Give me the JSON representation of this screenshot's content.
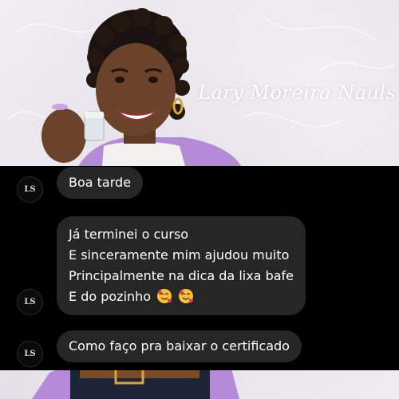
{
  "brand": {
    "signature": "Lary Moreira Nauls"
  },
  "messages": [
    {
      "lines": [
        "Boa tarde"
      ]
    },
    {
      "lines": [
        "Já terminei o curso",
        "E sinceramente mim ajudou muito",
        "Principalmente na dica da lixa bafe",
        "E do pozinho"
      ],
      "trailing_emojis": [
        "smiling-face-with-hearts",
        "smiling-face-with-hearts"
      ]
    },
    {
      "lines": [
        "Como faço pra baixar o certificado"
      ]
    }
  ],
  "sender_avatar": {
    "initials": "LS"
  },
  "colors": {
    "chat_background": "#000000",
    "bubble_background": "#262626",
    "bubble_text": "#ffffff",
    "jacket": "#b58ad6"
  }
}
